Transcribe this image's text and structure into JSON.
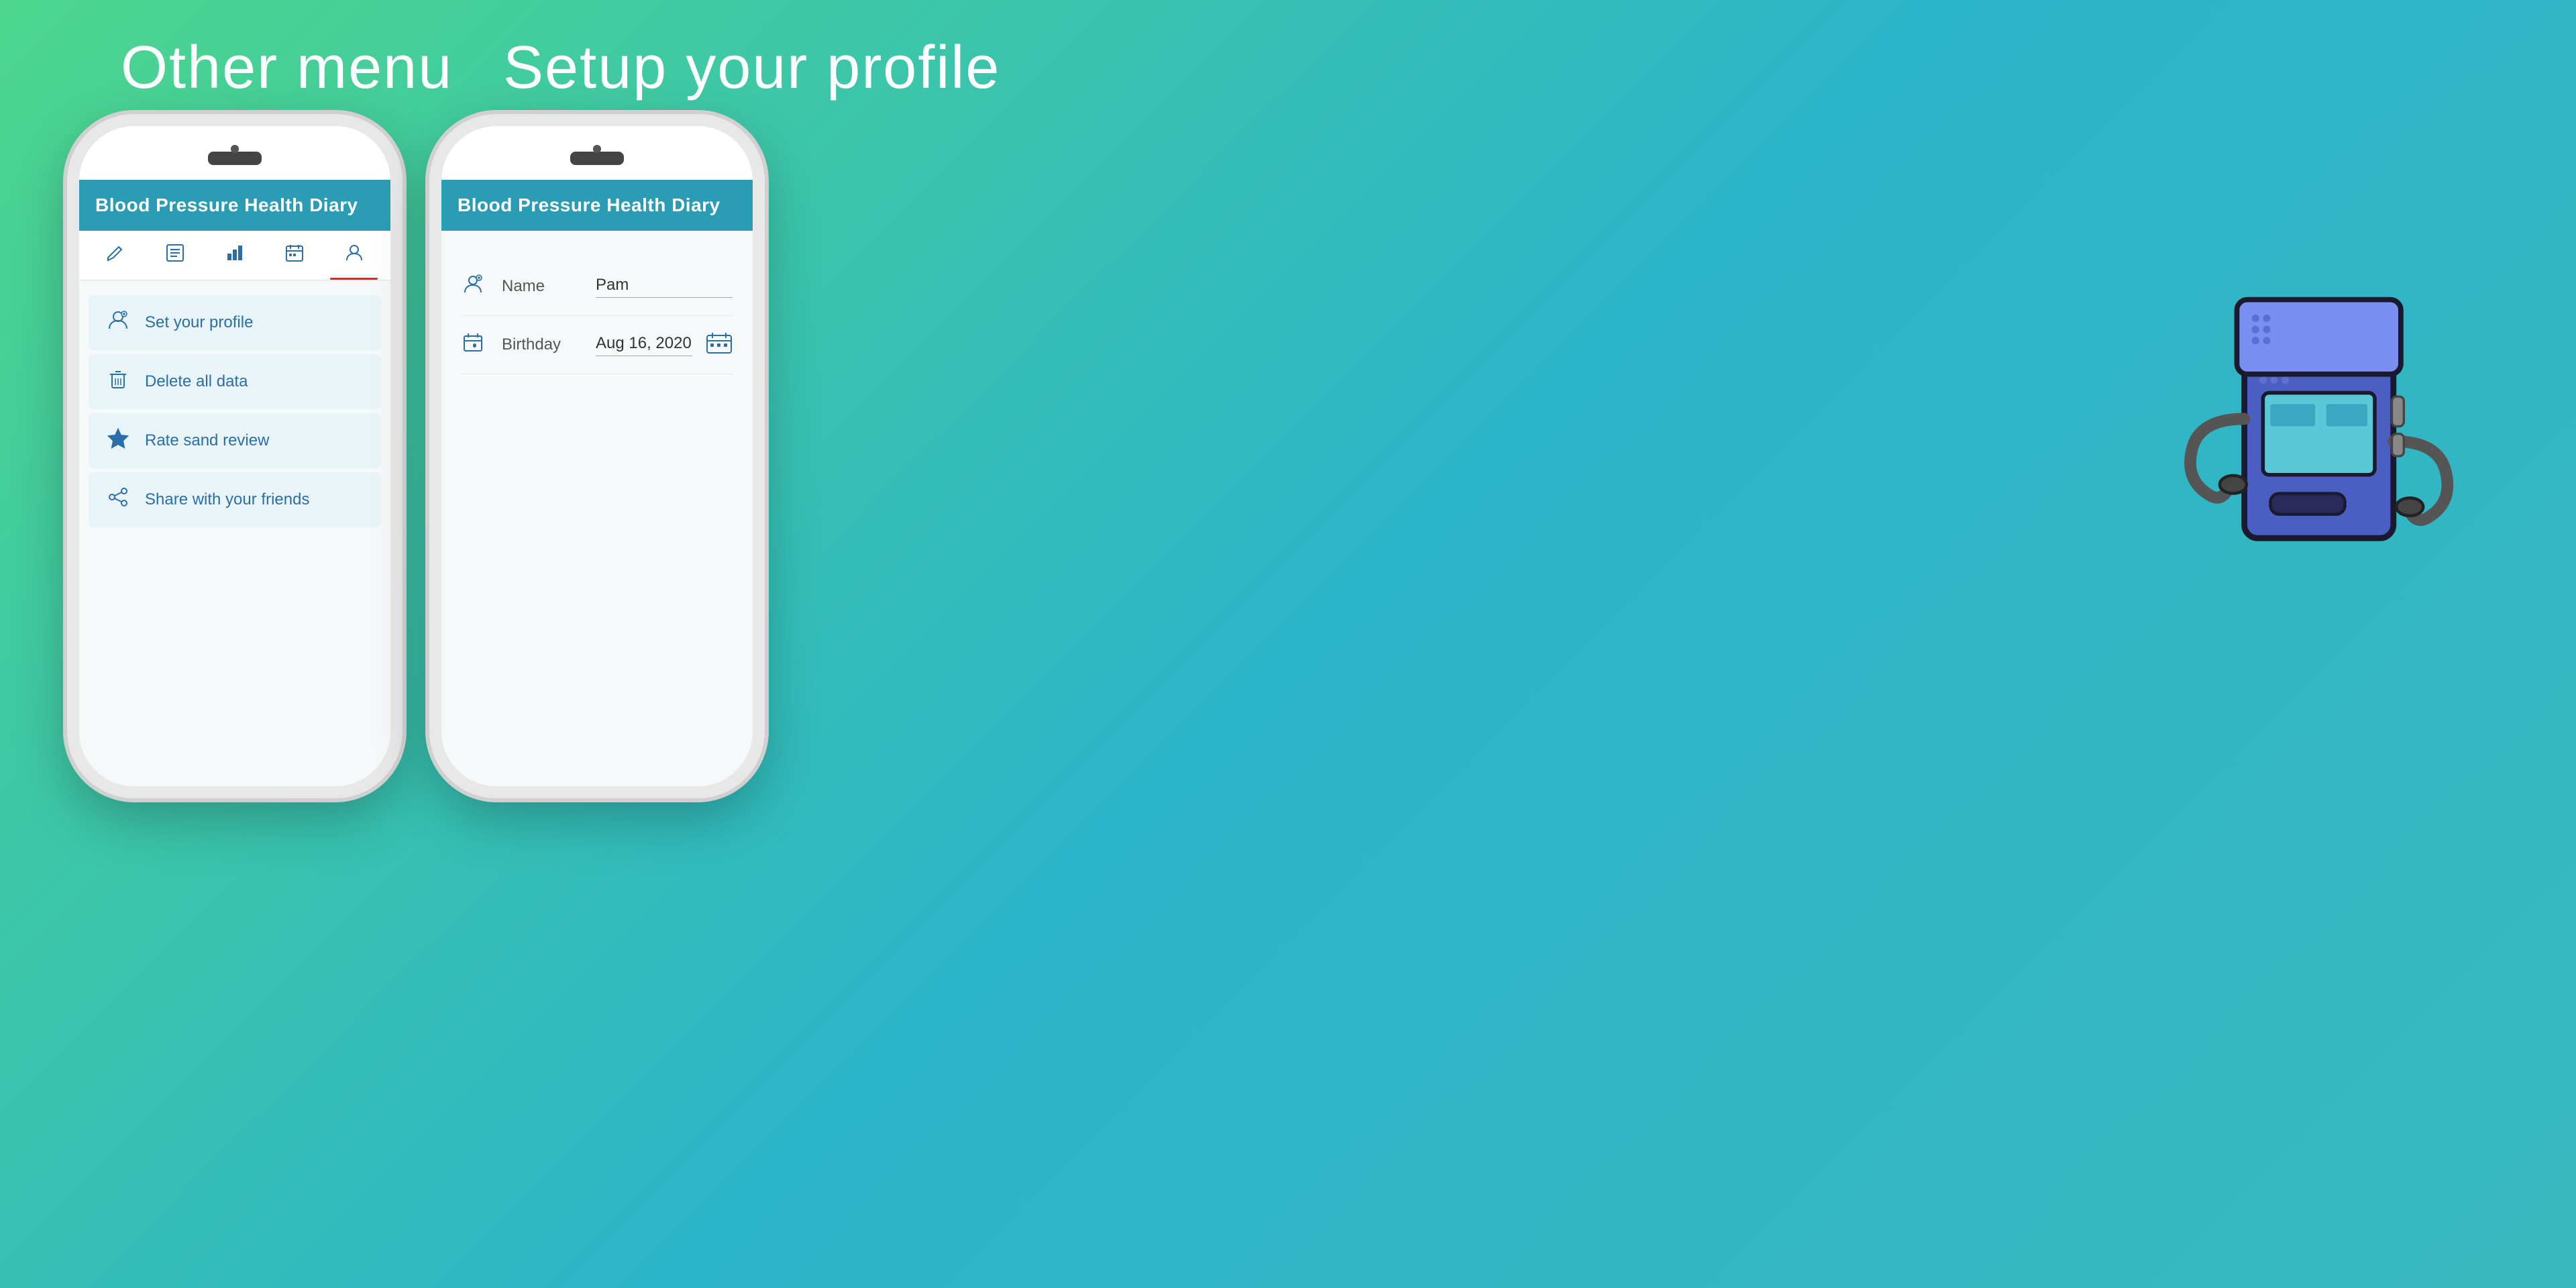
{
  "titles": {
    "left": "Other menu",
    "right": "Setup your profile"
  },
  "app": {
    "name": "Blood Pressure Health Diary"
  },
  "left_phone": {
    "tabs": [
      {
        "id": "edit",
        "label": "Edit",
        "icon": "✏️",
        "active": false
      },
      {
        "id": "list",
        "label": "List",
        "icon": "📋",
        "active": false
      },
      {
        "id": "stats",
        "label": "Stats",
        "icon": "🏛️",
        "active": false
      },
      {
        "id": "calendar",
        "label": "Calendar",
        "icon": "📅",
        "active": false
      },
      {
        "id": "profile",
        "label": "Profile",
        "icon": "👤",
        "active": true
      }
    ],
    "menu_items": [
      {
        "id": "set-profile",
        "icon": "👤",
        "label": "Set your profile"
      },
      {
        "id": "delete-data",
        "icon": "🗑️",
        "label": "Delete all data"
      },
      {
        "id": "rate-review",
        "icon": "⭐",
        "label": "Rate sand review"
      },
      {
        "id": "share-friends",
        "icon": "🔗",
        "label": "Share with your friends"
      }
    ]
  },
  "right_phone": {
    "form": {
      "name_label": "Name",
      "name_value": "Pam",
      "birthday_label": "Birthday",
      "birthday_value": "Aug 16, 2020"
    }
  },
  "colors": {
    "app_header": "#2a9db5",
    "tab_active_underline": "#c0392b",
    "menu_bg": "#e8f4f8",
    "icon_color": "#2a6fa8",
    "device_blue_dark": "#4a5fc1",
    "device_blue_light": "#7a8ff0",
    "device_cyan": "#5bc8d8"
  }
}
